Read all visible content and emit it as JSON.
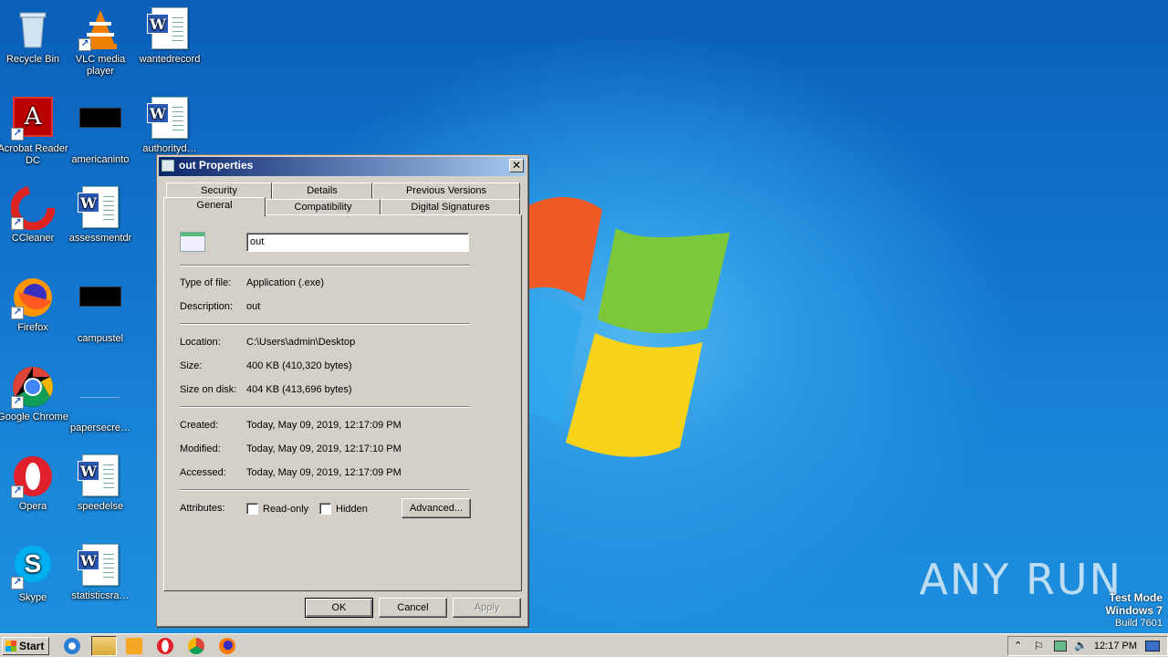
{
  "desktop": {
    "icons": [
      {
        "label": "Recycle Bin",
        "icon": "recycle-bin-icon"
      },
      {
        "label": "VLC media player",
        "icon": "vlc-icon"
      },
      {
        "label": "wantedrecord",
        "icon": "word-document-icon"
      },
      {
        "label": "Acrobat Reader DC",
        "icon": "acrobat-icon"
      },
      {
        "label": "americaninto",
        "icon": "black-file-icon"
      },
      {
        "label": "authorityd…",
        "icon": "word-document-icon"
      },
      {
        "label": "CCleaner",
        "icon": "ccleaner-icon"
      },
      {
        "label": "assessmentdr",
        "icon": "word-document-icon"
      },
      {
        "label": "Firefox",
        "icon": "firefox-icon"
      },
      {
        "label": "campustel",
        "icon": "black-file-icon"
      },
      {
        "label": "Google Chrome",
        "icon": "chrome-icon"
      },
      {
        "label": "papersecre…",
        "icon": "blank-file-icon"
      },
      {
        "label": "Opera",
        "icon": "opera-icon"
      },
      {
        "label": "speedelse",
        "icon": "word-document-icon"
      },
      {
        "label": "Skype",
        "icon": "skype-icon"
      },
      {
        "label": "statisticsra…",
        "icon": "word-document-icon"
      }
    ],
    "watermark": "ANY RUN",
    "test_mode": {
      "line1": "Test Mode",
      "line2": "Windows 7",
      "line3": "Build 7601"
    }
  },
  "dialog": {
    "title": "out Properties",
    "close_label": "✕",
    "tabs_back": [
      "Security",
      "Details",
      "Previous Versions"
    ],
    "tabs_front": [
      "General",
      "Compatibility",
      "Digital Signatures"
    ],
    "active_tab": "General",
    "filename": "out",
    "type_label": "Type of file:",
    "type_value": "Application (.exe)",
    "desc_label": "Description:",
    "desc_value": "out",
    "location_label": "Location:",
    "location_value": "C:\\Users\\admin\\Desktop",
    "size_label": "Size:",
    "size_value": "400 KB (410,320 bytes)",
    "disk_label": "Size on disk:",
    "disk_value": "404 KB (413,696 bytes)",
    "created_label": "Created:",
    "created_value": "Today, May 09, 2019, 12:17:09 PM",
    "modified_label": "Modified:",
    "modified_value": "Today, May 09, 2019, 12:17:10 PM",
    "accessed_label": "Accessed:",
    "accessed_value": "Today, May 09, 2019, 12:17:09 PM",
    "attributes_label": "Attributes:",
    "readonly_label": "Read-only",
    "readonly_checked": false,
    "hidden_label": "Hidden",
    "hidden_checked": false,
    "advanced_label": "Advanced...",
    "ok_label": "OK",
    "cancel_label": "Cancel",
    "apply_label": "Apply"
  },
  "taskbar": {
    "start_label": "Start",
    "clock": "12:17 PM"
  }
}
